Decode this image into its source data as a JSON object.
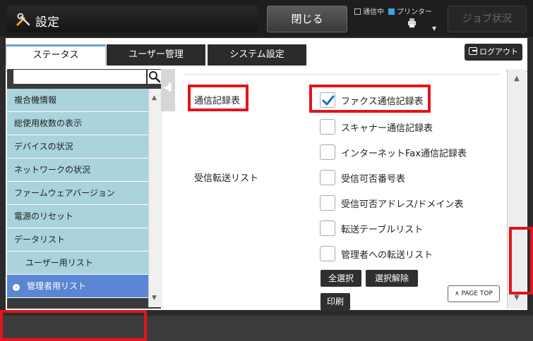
{
  "header": {
    "title": "設定",
    "close_label": "閉じる",
    "status_comm": "通信中",
    "status_printer": "プリンター",
    "job_status_label": "ジョブ状況"
  },
  "tabs": [
    {
      "label": "ステータス",
      "active": true
    },
    {
      "label": "ユーザー管理",
      "active": false
    },
    {
      "label": "システム設定",
      "active": false
    }
  ],
  "logout_label": "ログアウト",
  "search": {
    "placeholder": "",
    "value": ""
  },
  "sidebar": {
    "items": [
      {
        "label": "複合機情報"
      },
      {
        "label": "総使用枚数の表示"
      },
      {
        "label": "デバイスの状況"
      },
      {
        "label": "ネットワークの状況"
      },
      {
        "label": "ファームウェアバージョン"
      },
      {
        "label": "電源のリセット"
      },
      {
        "label": "データリスト"
      },
      {
        "label": "ユーザー用リスト"
      },
      {
        "label": "管理者用リスト",
        "active": true
      }
    ]
  },
  "content": {
    "section1_label": "通信記録表",
    "section2_label": "受信転送リスト",
    "options": [
      {
        "label": "ファクス通信記録表",
        "checked": true
      },
      {
        "label": "スキャナー通信記録表",
        "checked": false
      },
      {
        "label": "インターネットFax通信記録表",
        "checked": false
      },
      {
        "label": "受信可否番号表",
        "checked": false
      },
      {
        "label": "受信可否アドレス/ドメイン表",
        "checked": false
      },
      {
        "label": "転送テーブルリスト",
        "checked": false
      },
      {
        "label": "管理者への転送リスト",
        "checked": false
      }
    ],
    "select_all_label": "全選択",
    "deselect_label": "選択解除",
    "print_label": "印刷",
    "page_top_label": "PAGE TOP"
  },
  "colors": {
    "nav_bg": "#a9d3dd",
    "nav_active": "#5a86d3",
    "highlight": "#e3141c",
    "check_blue": "#1e6fc8"
  }
}
